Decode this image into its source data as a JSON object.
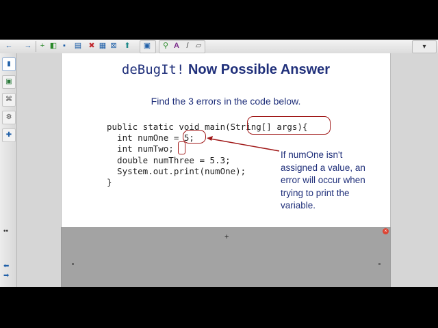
{
  "toolbar": {
    "new_page_icon": "+",
    "undo_icon": "←",
    "redo_icon": "→",
    "delete_icon": "✖",
    "pen_icon": "A",
    "line_icon": "/",
    "eraser_icon": "▱",
    "menu_icon": "▾"
  },
  "sidebar": {
    "page_sorter_icon": "▮",
    "gallery_icon": "▣",
    "attachments_icon": "⌘",
    "properties_icon": "⚙",
    "addons_icon": "✚",
    "collapse_icon": "••",
    "prev_icon": "⬅",
    "next_icon": "➡"
  },
  "slide": {
    "title_mono": "deBugIt!",
    "title_bold": "Now Possible Answer",
    "subtitle": "Find the 3 errors in the code below.",
    "code": "public static void main(String[] args){\n  int numOne = 5;\n  int numTwo;\n  double numThree = 5.3;\n  System.out.print(numOne);\n}",
    "note": "If numOne isn't assigned a value, an error will occur when trying to print the variable."
  },
  "panel": {
    "close_icon": "×",
    "cursor_icon": "+"
  },
  "colors": {
    "title": "#1f2f7a",
    "annotation": "#a01818",
    "panel": "#a3a3a3"
  }
}
